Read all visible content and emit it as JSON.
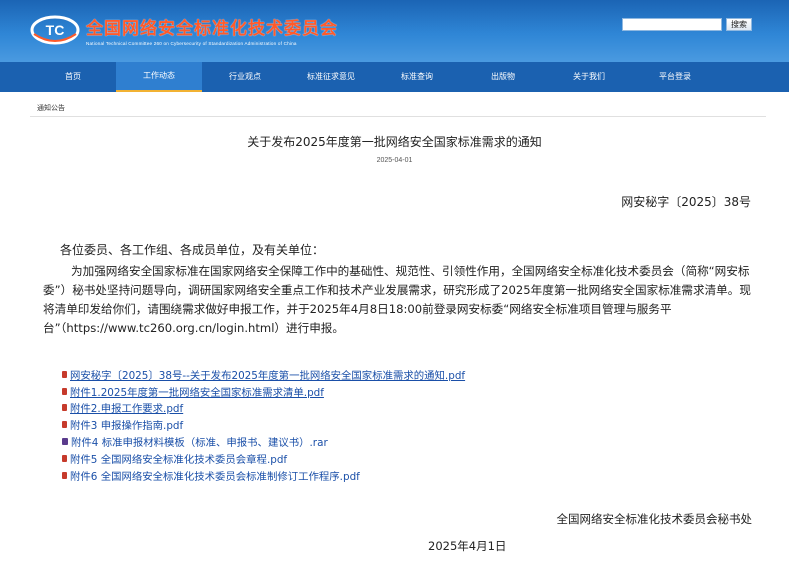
{
  "header": {
    "org_title": "全国网络安全标准化技术委员会",
    "org_subtitle": "National Technical Committee 260 on Cybersecurity of Standardization Administration of China",
    "search_placeholder": "",
    "search_button": "搜索"
  },
  "nav": {
    "items": [
      "首页",
      "工作动态",
      "行业观点",
      "标准征求意见",
      "标准查询",
      "出版物",
      "关于我们",
      "平台登录"
    ],
    "active": "工作动态"
  },
  "breadcrumb": "通知公告",
  "article": {
    "title": "关于发布2025年度第一批网络安全国家标准需求的通知",
    "date": "2025-04-01",
    "doc_number": "网安秘字〔2025〕38号",
    "salutation": "各位委员、各工作组、各成员单位，及有关单位：",
    "body": "为加强网络安全国家标准在国家网络安全保障工作中的基础性、规范性、引领性作用，全国网络安全标准化技术委员会（简称“网安标委”）秘书处坚持问题导向，调研国家网络安全重点工作和技术产业发展需求，研究形成了2025年度第一批网络安全国家标准需求清单。现将清单印发给你们，请围绕需求做好申报工作，并于2025年4月8日18:00前登录网安标委“网络安全标准项目管理与服务平台”（https://www.tc260.org.cn/login.html）进行申报。",
    "attachments": [
      {
        "label": "网安秘字〔2025〕38号--关于发布2025年度第一批网络安全国家标准需求的通知.pdf",
        "type": "pdf"
      },
      {
        "label": "附件1.2025年度第一批网络安全国家标准需求清单.pdf",
        "type": "pdf"
      },
      {
        "label": "附件2.申报工作要求.pdf",
        "type": "pdf"
      },
      {
        "label": "附件3 申报操作指南.pdf",
        "type": "pdf"
      },
      {
        "label": "附件4 标准申报材料模板（标准、申报书、建议书）.rar",
        "type": "rar"
      },
      {
        "label": "附件5 全国网络安全标准化技术委员会章程.pdf",
        "type": "pdf"
      },
      {
        "label": "附件6 全国网络安全标准化技术委员会标准制修订工作程序.pdf",
        "type": "pdf"
      }
    ],
    "signature_org": "全国网络安全标准化技术委员会秘书处",
    "signature_date": "2025年4月1日"
  },
  "colors": {
    "header_blue": "#1b64b4",
    "nav_blue": "#1b61b0",
    "title_orange": "#ff5a2a",
    "link_blue": "#1a4fa8",
    "active_underline": "#f2b233"
  },
  "icons": [
    "tc-logo-icon",
    "pdf-file-icon",
    "rar-file-icon"
  ]
}
